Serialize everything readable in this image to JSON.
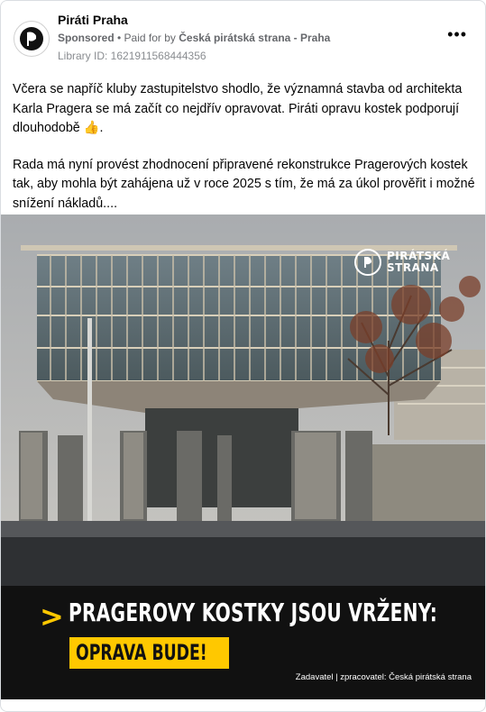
{
  "post": {
    "page_name": "Piráti Praha",
    "sponsored_label": "Sponsored",
    "separator": " • ",
    "paid_for_prefix": "Paid for by ",
    "paid_for_by": "Česká pirátská strana - Praha",
    "library_id": "Library ID: 1621911568444356",
    "more_label": "•••",
    "paragraphs": [
      "Včera se napříč kluby zastupitelstvo shodlo, že významná stavba od architekta Karla Pragera se má začít co nejdřív opravovat. Piráti opravu kostek podporují dlouhodobě 👍.",
      "Rada má nyní provést zhodnocení připravené rekonstrukce Pragerových kostek tak, aby mohla být zahájena už v roce 2025 s tím, že má za úkol prověřit i možné snížení nákladů...."
    ]
  },
  "image": {
    "badge_line1": "PIRÁTSKÁ",
    "badge_line2": "STRANA",
    "chevron": ">",
    "headline": "PRAGEROVY KOSTKY JSOU VRŽENY:",
    "highlight": "OPRAVA BUDE!",
    "disclaimer": "Zadavatel | zpracovatel: Česká pirátská strana",
    "colors": {
      "accent": "#ffc800",
      "banner": "#111111"
    }
  }
}
